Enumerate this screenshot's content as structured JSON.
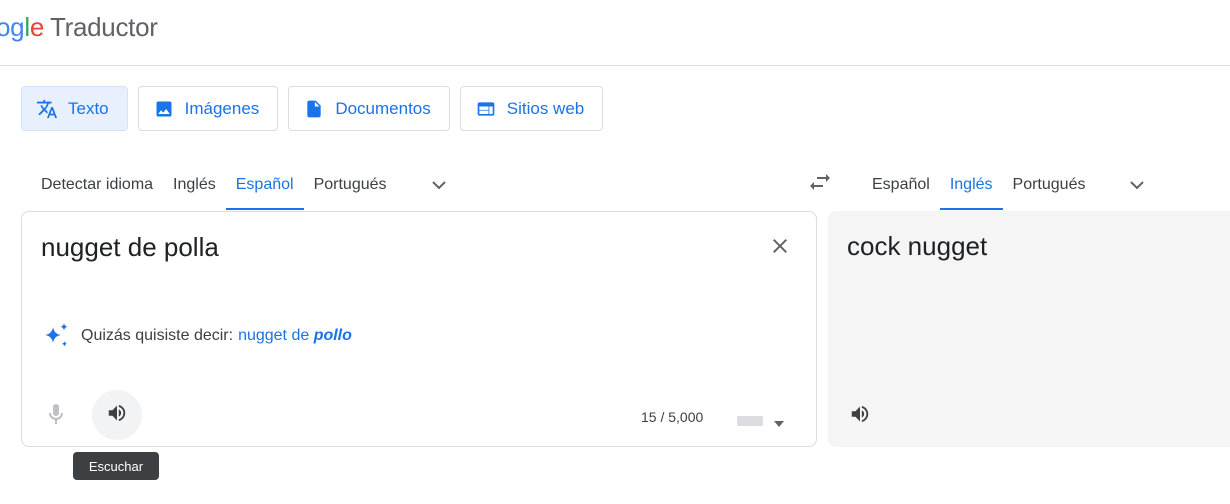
{
  "header": {
    "logo_partial": "ogle",
    "product": "Traductor"
  },
  "modes": [
    {
      "label": "Texto",
      "icon": "translate-icon",
      "active": true
    },
    {
      "label": "Imágenes",
      "icon": "image-icon",
      "active": false
    },
    {
      "label": "Documentos",
      "icon": "document-icon",
      "active": false
    },
    {
      "label": "Sitios web",
      "icon": "web-icon",
      "active": false
    }
  ],
  "source_langs": [
    "Detectar idioma",
    "Inglés",
    "Español",
    "Portugués"
  ],
  "target_langs": [
    "Español",
    "Inglés",
    "Portugués"
  ],
  "source": {
    "text": "nugget de polla",
    "suggest_prefix": "Quizás quisiste decir:",
    "suggest_plain": "nugget de ",
    "suggest_bold": "pollo",
    "char_count": "15 / 5,000"
  },
  "tooltip": "Escuchar",
  "target": {
    "text": "cock nugget"
  },
  "colors": {
    "accent": "#1a73e8",
    "active_bg": "#e8f0fe",
    "target_bg": "#f5f5f5"
  }
}
